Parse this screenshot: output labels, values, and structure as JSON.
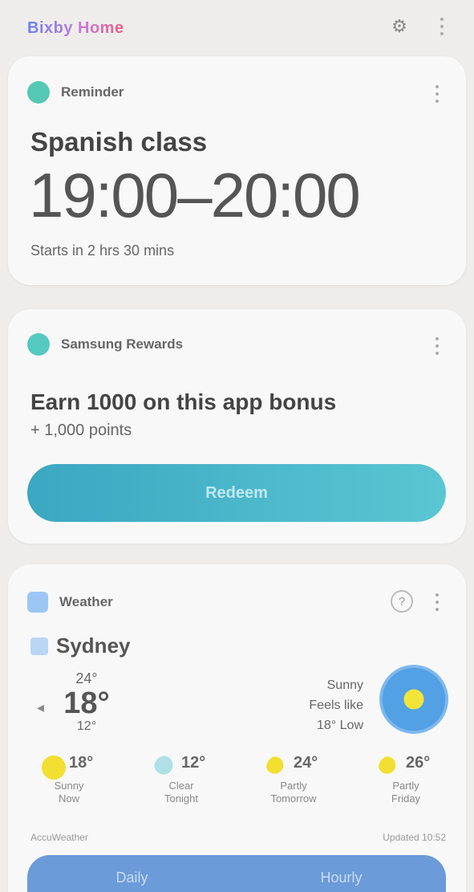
{
  "topbar": {
    "brand": "Bixby Home",
    "settings_icon": "gear-icon",
    "menu_icon": "kebab-icon"
  },
  "card1": {
    "app_name": "Reminder",
    "title": "Spanish class",
    "time": "19:00–20:00",
    "subtitle": "Starts in 2 hrs 30 mins",
    "dot_color": "#55c9b5"
  },
  "card2": {
    "app_name": "Samsung Rewards",
    "title": "Earn 1000 on this app bonus",
    "subtitle": "+ 1,000 points",
    "button_label": "Redeem",
    "dot_color": "#55c9c0"
  },
  "card3": {
    "app_name": "Weather",
    "location": "Sydney",
    "current": {
      "high": "24°",
      "temp": "18°",
      "low": "12°"
    },
    "condition_lines": [
      "Sunny",
      "Feels like",
      "18° Low"
    ],
    "forecast": [
      {
        "time": "Now",
        "temp": "18°",
        "desc": "Sunny",
        "icon": "sun-icon"
      },
      {
        "time": "Tonight",
        "temp": "12°",
        "desc": "Clear",
        "icon": "moon-icon"
      },
      {
        "time": "Tomorrow",
        "temp": "24°",
        "desc": "Partly",
        "icon": "partly-cloudy-icon"
      },
      {
        "time": "Friday",
        "temp": "26°",
        "desc": "Partly",
        "icon": "partly-cloudy-icon"
      }
    ],
    "updated_label": "Updated 10:52",
    "source_label": "AccuWeather",
    "buttons": [
      "Daily",
      "Hourly"
    ],
    "dot_color": "#9cc6f3"
  }
}
